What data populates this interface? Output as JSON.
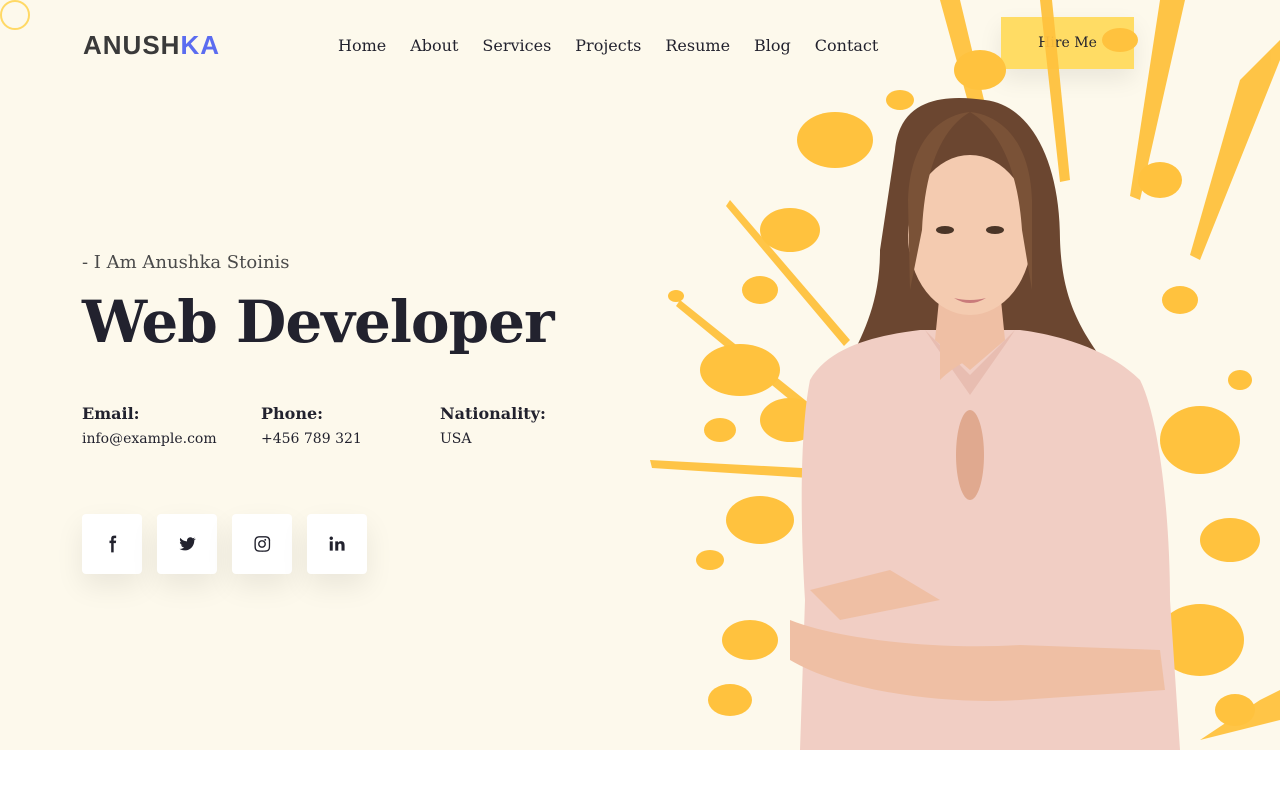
{
  "brand": {
    "name_dark": "ANUSH",
    "name_accent": "KA"
  },
  "nav": {
    "items": [
      "Home",
      "About",
      "Services",
      "Projects",
      "Resume",
      "Blog",
      "Contact"
    ]
  },
  "header": {
    "cta_label": "Hire Me"
  },
  "hero": {
    "intro": "- I Am Anushka Stoinis",
    "title": "Web Developer",
    "contact": [
      {
        "label": "Email:",
        "value": "info@example.com"
      },
      {
        "label": "Phone:",
        "value": "+456 789 321"
      },
      {
        "label": "Nationality:",
        "value": "USA"
      }
    ],
    "socials": [
      "facebook-icon",
      "twitter-icon",
      "instagram-icon",
      "linkedin-icon"
    ]
  },
  "colors": {
    "hero_bg": "#fdf9ec",
    "accent_yellow": "#ffdc64",
    "splash_orange": "#ffc23e",
    "logo_accent": "#5b6cf0",
    "text_dark": "#22222e"
  }
}
